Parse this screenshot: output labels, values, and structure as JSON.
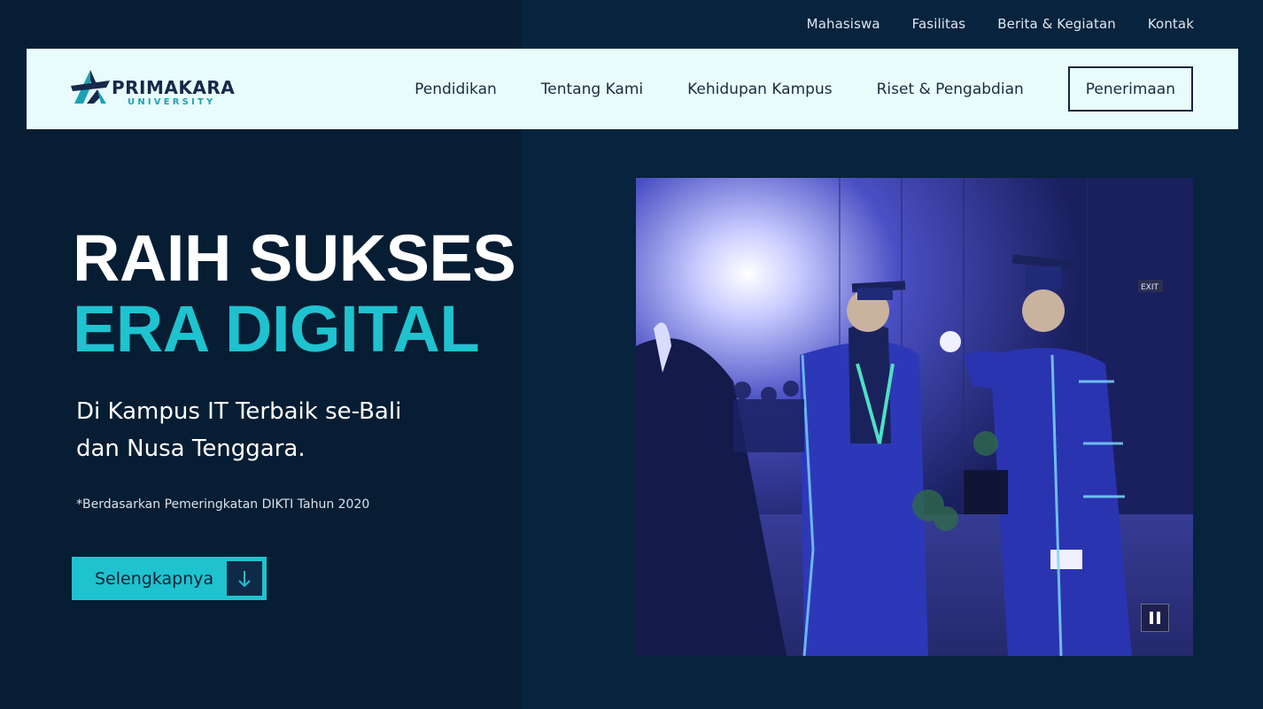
{
  "top_nav": {
    "items": [
      {
        "label": "Mahasiswa"
      },
      {
        "label": "Fasilitas"
      },
      {
        "label": "Berita & Kegiatan"
      },
      {
        "label": "Kontak"
      }
    ]
  },
  "header": {
    "logo": {
      "name": "PRIMAKARA",
      "sub": "UNIVERSITY"
    },
    "nav": [
      {
        "label": "Pendidikan"
      },
      {
        "label": "Tentang Kami"
      },
      {
        "label": "Kehidupan Kampus"
      },
      {
        "label": "Riset & Pengabdian"
      }
    ],
    "cta_label": "Penerimaan"
  },
  "hero": {
    "title_line1": "RAIH SUKSES",
    "title_line2": "ERA DIGITAL",
    "subtitle_line1": "Di Kampus IT Terbaik se-Bali",
    "subtitle_line2": "dan Nusa Tenggara.",
    "note": "*Berdasarkan Pemeringkatan DIKTI Tahun 2020",
    "button_label": "Selengkapnya",
    "button_icon": "arrow-down-icon"
  },
  "video": {
    "control_icon": "pause-icon",
    "exit_sign": "EXIT"
  },
  "colors": {
    "accent": "#1fc2cf",
    "navy": "#061d33",
    "header_bg": "#e8fcfc"
  }
}
